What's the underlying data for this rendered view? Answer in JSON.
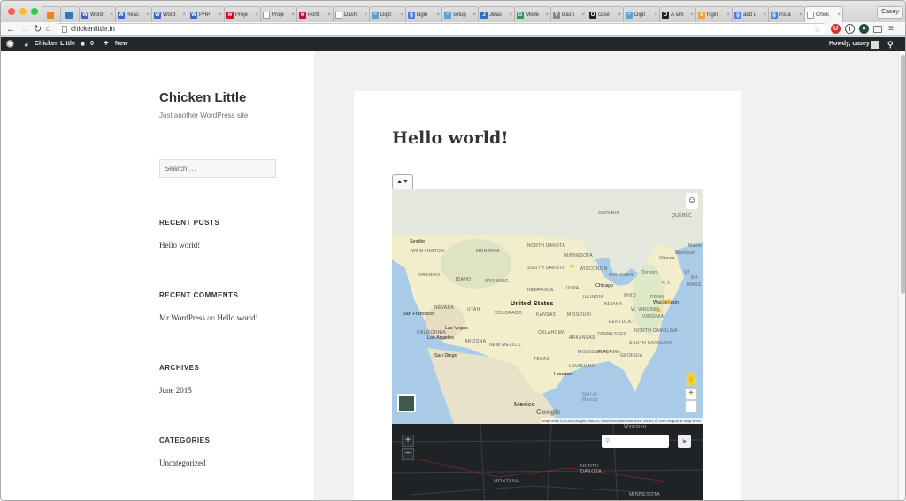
{
  "browser": {
    "tabs": [
      {
        "title": "Word",
        "color": "#3a66c4",
        "letter": "W"
      },
      {
        "title": "Reac",
        "color": "#3a66c4",
        "letter": "W"
      },
      {
        "title": "Word",
        "color": "#3a66c4",
        "letter": "W"
      },
      {
        "title": "PHP",
        "color": "#3a66c4",
        "letter": "W"
      },
      {
        "title": "Proje",
        "color": "#c8102e",
        "letter": "w"
      },
      {
        "title": "Proje",
        "color": "#ffffff",
        "letter": ""
      },
      {
        "title": "Portf",
        "color": "#c8102e",
        "letter": "w"
      },
      {
        "title": "Dash",
        "color": "#ffffff",
        "letter": ""
      },
      {
        "title": "Digit",
        "color": "#60a0d0",
        "letter": "~"
      },
      {
        "title": "Ngin",
        "color": "#4a7fe0",
        "letter": "g"
      },
      {
        "title": "setup",
        "color": "#60a0d0",
        "letter": "~"
      },
      {
        "title": "Jelas",
        "color": "#2d6fc9",
        "letter": "J"
      },
      {
        "title": "Mode",
        "color": "#20a050",
        "letter": "G"
      },
      {
        "title": "Dash",
        "color": "#888888",
        "letter": "V"
      },
      {
        "title": "case",
        "color": "#222222",
        "letter": "O"
      },
      {
        "title": "Digit",
        "color": "#60a0d0",
        "letter": "~"
      },
      {
        "title": "A sim",
        "color": "#222222",
        "letter": "O"
      },
      {
        "title": "Ngin",
        "color": "#f0a030",
        "letter": "o"
      },
      {
        "title": "add u",
        "color": "#4a7fe0",
        "letter": "g"
      },
      {
        "title": "insta",
        "color": "#4a7fe0",
        "letter": "g"
      },
      {
        "title": "Chick",
        "color": "#ffffff",
        "letter": "",
        "active": true
      }
    ],
    "profile": "Casey",
    "url": "chickenlittle.in"
  },
  "adminbar": {
    "site": "Chicken Little",
    "comments": "0",
    "new": "New",
    "howdy": "Howdy, casey"
  },
  "site": {
    "title": "Chicken Little",
    "tagline": "Just another WordPress site",
    "search_placeholder": "Search …"
  },
  "widgets": {
    "recent_posts": {
      "heading": "RECENT POSTS",
      "item": "Hello world!"
    },
    "recent_comments": {
      "heading": "RECENT COMMENTS",
      "author": "Mr WordPress",
      "on": "on",
      "post": "Hello world!"
    },
    "archives": {
      "heading": "ARCHIVES",
      "item": "June 2015"
    },
    "categories": {
      "heading": "CATEGORIES",
      "item": "Uncategorized"
    }
  },
  "post": {
    "title": "Hello world!"
  },
  "map": {
    "country_label": "United States",
    "mexico": "Mexico",
    "regions": [
      "ONTARIO",
      "QUÉBEC",
      "WASHINGTON",
      "MONTANA",
      "NORTH DAKOTA",
      "SOUTH DAKOTA",
      "MINNESOTA",
      "WISCONSIN",
      "MICHIGAN",
      "OREGON",
      "IDAHO",
      "WYOMING",
      "NEBRASKA",
      "IOWA",
      "ILLINOIS",
      "INDIANA",
      "OHIO",
      "PENN",
      "NEVADA",
      "UTAH",
      "COLORADO",
      "KANSAS",
      "MISSOURI",
      "KENTUCKY",
      "VIRGINIA",
      "CALIFORNIA",
      "ARIZONA",
      "NEW MEXICO",
      "OKLAHOMA",
      "ARKANSAS",
      "TENNESSEE",
      "NORTH CAROLINA",
      "SOUTH CAROLINA",
      "MISSISSIPPI",
      "ALABAMA",
      "GEORGIA",
      "TEXAS",
      "LOUISIANA",
      "Gulf of Mexico",
      "Maine",
      "N.Y.",
      "Ottawa",
      "Toronto",
      "Montreal",
      "VT",
      "NH",
      "MASS",
      "W. VIRGINIA"
    ],
    "cities": [
      "Seattle",
      "Chicago",
      "San Francisco",
      "Las Vegas",
      "Los Angeles",
      "San Diego",
      "Houston",
      "Washington"
    ],
    "attribution": "Map data ©2015 Google, INEGI, Inav/Geosistemas SRL  Terms of Use  Report a map error",
    "dark_labels": [
      "Winnipeg",
      "NORTH DAKOTA",
      "MONTANA",
      "MINNESOTA"
    ]
  }
}
